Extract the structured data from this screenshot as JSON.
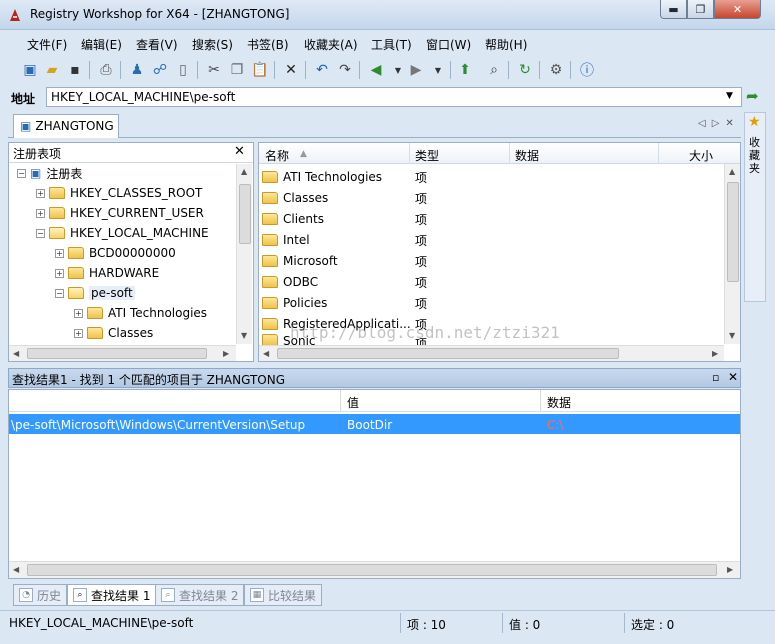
{
  "window": {
    "title": "Registry Workshop for X64 - [ZHANGTONG]",
    "min": "▬",
    "max": "❐",
    "close": "✕"
  },
  "menu": [
    "文件(F)",
    "编辑(E)",
    "查看(V)",
    "搜索(S)",
    "书签(B)",
    "收藏夹(A)",
    "工具(T)",
    "窗口(W)",
    "帮助(H)"
  ],
  "toolbar": {
    "icons": [
      "computer-icon",
      "open-icon",
      "save-icon",
      "print-icon",
      "connect-icon",
      "network-icon",
      "disk-icon",
      "cut-icon",
      "copy-icon",
      "paste-icon",
      "delete-icon",
      "undo-icon",
      "redo-icon",
      "back-icon",
      "forward-icon",
      "up-icon",
      "find-icon",
      "refresh-icon",
      "options-icon",
      "help-icon"
    ]
  },
  "address": {
    "label": "地址",
    "value": "HKEY_LOCAL_MACHINE\\pe-soft"
  },
  "tab": {
    "label": "ZHANGTONG"
  },
  "favorites": {
    "label": "收藏夹"
  },
  "tree": {
    "title": "注册表项",
    "close": "✕",
    "items": [
      {
        "label": "注册表",
        "expander": "−"
      },
      {
        "label": "HKEY_CLASSES_ROOT",
        "expander": "+"
      },
      {
        "label": "HKEY_CURRENT_USER",
        "expander": "+"
      },
      {
        "label": "HKEY_LOCAL_MACHINE",
        "expander": "−"
      },
      {
        "label": "BCD00000000",
        "expander": "+"
      },
      {
        "label": "HARDWARE",
        "expander": "+"
      },
      {
        "label": "pe-soft",
        "expander": "−"
      },
      {
        "label": "ATI Technologies",
        "expander": "+"
      },
      {
        "label": "Classes",
        "expander": "+"
      }
    ]
  },
  "list": {
    "columns": [
      "名称",
      "类型",
      "数据",
      "大小"
    ],
    "rows": [
      {
        "name": "ATI Technologies",
        "type": "项"
      },
      {
        "name": "Classes",
        "type": "项"
      },
      {
        "name": "Clients",
        "type": "项"
      },
      {
        "name": "Intel",
        "type": "项"
      },
      {
        "name": "Microsoft",
        "type": "项"
      },
      {
        "name": "ODBC",
        "type": "项"
      },
      {
        "name": "Policies",
        "type": "项"
      },
      {
        "name": "RegisteredApplicati...",
        "type": "项"
      },
      {
        "name": "Sonic",
        "type": "项"
      }
    ]
  },
  "watermark": "http://blog.csdn.net/ztzi321",
  "results": {
    "title": "查找结果1 - 找到 1 个匹配的项目于 ZHANGTONG",
    "pin": "📌",
    "close": "✕",
    "columns": [
      "值",
      "数据"
    ],
    "row": {
      "path": "\\pe-soft\\Microsoft\\Windows\\CurrentVersion\\Setup",
      "value": "BootDir",
      "data": "C:\\"
    },
    "data_color": "#ff6a5a"
  },
  "bottom_tabs": [
    "历史",
    "查找结果 1",
    "查找结果 2",
    "比较结果"
  ],
  "status": {
    "path": "HKEY_LOCAL_MACHINE\\pe-soft",
    "items": "项 : 10",
    "values": "值 : 0",
    "selected": "选定 : 0"
  },
  "accent": "#3399ff"
}
